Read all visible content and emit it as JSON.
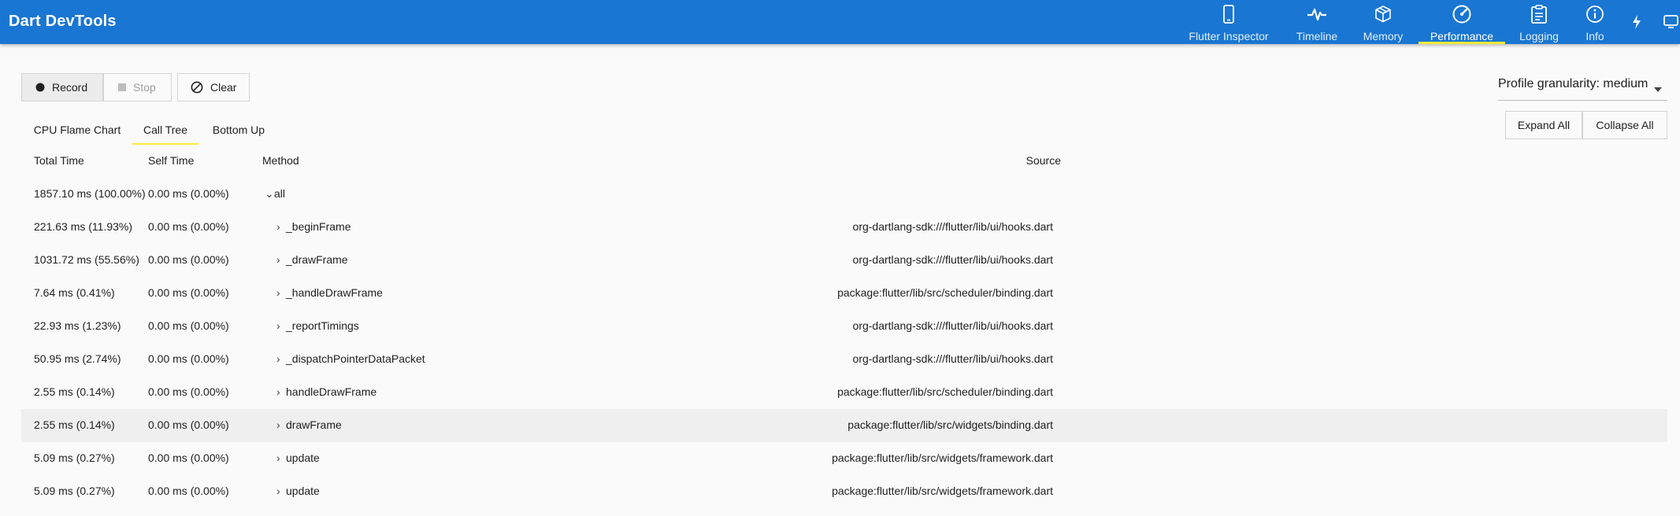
{
  "app": {
    "title": "Dart DevTools"
  },
  "nav": {
    "tabs": [
      {
        "label": "Flutter Inspector",
        "icon": "phone-icon"
      },
      {
        "label": "Timeline",
        "icon": "pulse-icon"
      },
      {
        "label": "Memory",
        "icon": "box-icon"
      },
      {
        "label": "Performance",
        "icon": "speedometer-icon"
      },
      {
        "label": "Logging",
        "icon": "clipboard-icon"
      },
      {
        "label": "Info",
        "icon": "info-icon"
      }
    ],
    "active": "Performance"
  },
  "colors": {
    "appbar": "#1976d2",
    "accent": "#ffeb3b"
  },
  "controls": {
    "record_label": "Record",
    "stop_label": "Stop",
    "clear_label": "Clear",
    "granularity_label": "Profile granularity: medium",
    "expand_all_label": "Expand All",
    "collapse_all_label": "Collapse All"
  },
  "subtabs": [
    {
      "label": "CPU Flame Chart"
    },
    {
      "label": "Call Tree"
    },
    {
      "label": "Bottom Up"
    }
  ],
  "active_subtab": "Call Tree",
  "table": {
    "headers": {
      "total": "Total Time",
      "self": "Self Time",
      "method": "Method",
      "source": "Source"
    },
    "rows": [
      {
        "total": "1857.10 ms (100.00%)",
        "self": "0.00 ms (0.00%)",
        "method": "all",
        "source": "",
        "depth": 0,
        "expanded": true
      },
      {
        "total": "221.63 ms (11.93%)",
        "self": "0.00 ms (0.00%)",
        "method": "_beginFrame",
        "source": "org-dartlang-sdk:///flutter/lib/ui/hooks.dart",
        "depth": 1,
        "expanded": false
      },
      {
        "total": "1031.72 ms (55.56%)",
        "self": "0.00 ms (0.00%)",
        "method": "_drawFrame",
        "source": "org-dartlang-sdk:///flutter/lib/ui/hooks.dart",
        "depth": 1,
        "expanded": false
      },
      {
        "total": "7.64 ms (0.41%)",
        "self": "0.00 ms (0.00%)",
        "method": "_handleDrawFrame",
        "source": "package:flutter/lib/src/scheduler/binding.dart",
        "depth": 1,
        "expanded": false
      },
      {
        "total": "22.93 ms (1.23%)",
        "self": "0.00 ms (0.00%)",
        "method": "_reportTimings",
        "source": "org-dartlang-sdk:///flutter/lib/ui/hooks.dart",
        "depth": 1,
        "expanded": false
      },
      {
        "total": "50.95 ms (2.74%)",
        "self": "0.00 ms (0.00%)",
        "method": "_dispatchPointerDataPacket",
        "source": "org-dartlang-sdk:///flutter/lib/ui/hooks.dart",
        "depth": 1,
        "expanded": false
      },
      {
        "total": "2.55 ms (0.14%)",
        "self": "0.00 ms (0.00%)",
        "method": "handleDrawFrame",
        "source": "package:flutter/lib/src/scheduler/binding.dart",
        "depth": 1,
        "expanded": false
      },
      {
        "total": "2.55 ms (0.14%)",
        "self": "0.00 ms (0.00%)",
        "method": "drawFrame",
        "source": "package:flutter/lib/src/widgets/binding.dart",
        "depth": 1,
        "expanded": false,
        "selected": true
      },
      {
        "total": "5.09 ms (0.27%)",
        "self": "0.00 ms (0.00%)",
        "method": "update",
        "source": "package:flutter/lib/src/widgets/framework.dart",
        "depth": 1,
        "expanded": false
      },
      {
        "total": "5.09 ms (0.27%)",
        "self": "0.00 ms (0.00%)",
        "method": "update",
        "source": "package:flutter/lib/src/widgets/framework.dart",
        "depth": 1,
        "expanded": false
      }
    ]
  }
}
